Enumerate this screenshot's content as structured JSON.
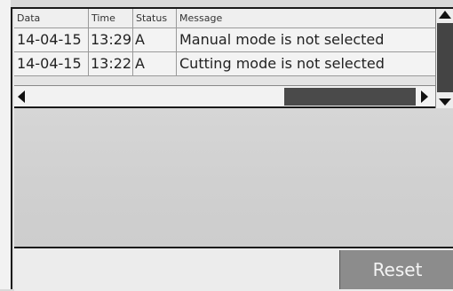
{
  "log_table": {
    "columns": [
      "Data",
      "Time",
      "Status",
      "Message"
    ],
    "rows": [
      {
        "date": "14-04-15",
        "time": "13:29",
        "status": "A",
        "message": "Manual mode is not selected"
      },
      {
        "date": "14-04-15",
        "time": "13:22",
        "status": "A",
        "message": "Cutting mode is not selected"
      }
    ]
  },
  "buttons": {
    "reset_label": "Reset"
  },
  "icons": {
    "scroll_up": "arrow-up-icon",
    "scroll_down": "arrow-down-icon",
    "scroll_left": "arrow-left-icon",
    "scroll_right": "arrow-right-icon"
  },
  "colors": {
    "reset_button_bg": "#8c8c8c",
    "scrollbar_thumb": "#444444"
  }
}
